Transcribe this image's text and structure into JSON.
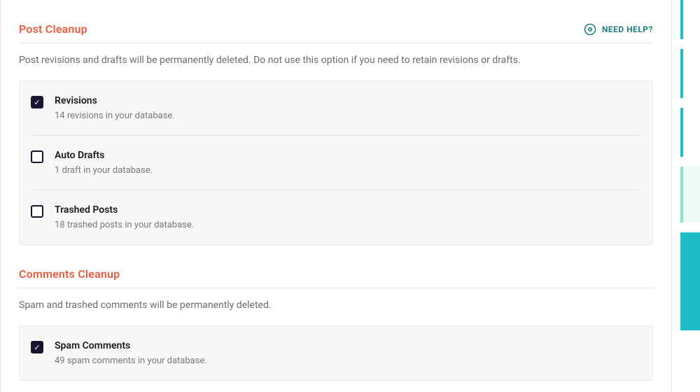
{
  "help": {
    "label": "NEED HELP?"
  },
  "sections": {
    "post_cleanup": {
      "title": "Post Cleanup",
      "description": "Post revisions and drafts will be permanently deleted. Do not use this option if you need to retain revisions or drafts.",
      "options": {
        "revisions": {
          "label": "Revisions",
          "sub": "14 revisions in your database.",
          "checked": true
        },
        "auto_drafts": {
          "label": "Auto Drafts",
          "sub": "1 draft in your database.",
          "checked": false
        },
        "trashed_posts": {
          "label": "Trashed Posts",
          "sub": "18 trashed posts in your database.",
          "checked": false
        }
      }
    },
    "comments_cleanup": {
      "title": "Comments Cleanup",
      "description": "Spam and trashed comments will be permanently deleted.",
      "options": {
        "spam_comments": {
          "label": "Spam Comments",
          "sub": "49 spam comments in your database.",
          "checked": true
        }
      }
    }
  }
}
